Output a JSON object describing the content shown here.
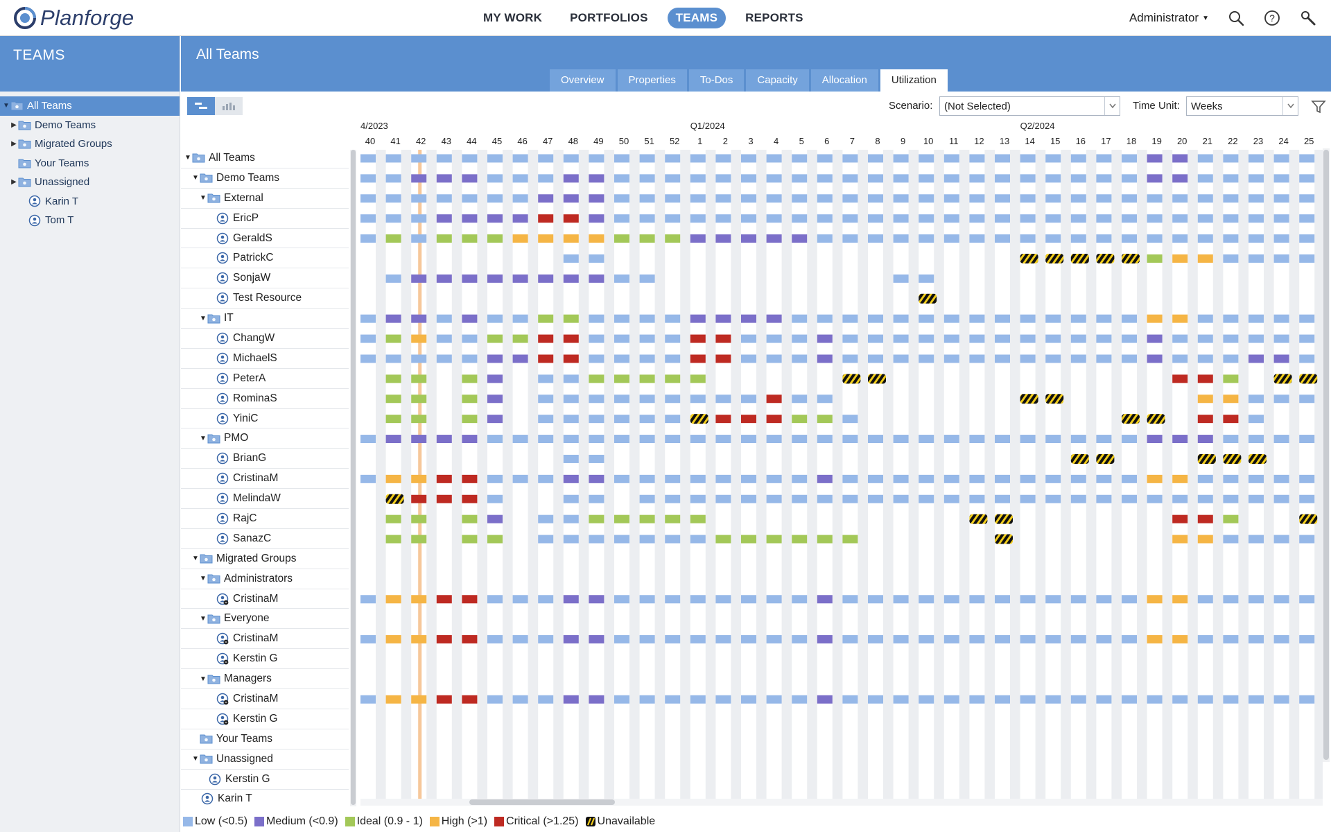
{
  "app": {
    "brand": "Planforge"
  },
  "nav": {
    "items": [
      "MY WORK",
      "PORTFOLIOS",
      "TEAMS",
      "REPORTS"
    ],
    "active": "TEAMS"
  },
  "user": {
    "name": "Administrator"
  },
  "icons": {
    "search": "search-icon",
    "help": "help-icon",
    "tools": "wrench-icon",
    "filter": "filter-icon"
  },
  "colors": {
    "brand_blue": "#5b8fcf",
    "low": "#96b8e8",
    "medium": "#7b6fc9",
    "ideal": "#a3c858",
    "high": "#f5b545",
    "critical": "#be2a22",
    "unavailable_stripe": "#f2cd1a"
  },
  "leftpanel": {
    "title": "TEAMS",
    "items": [
      {
        "label": "All Teams",
        "kind": "group",
        "level": 0,
        "expanded": true,
        "selected": true
      },
      {
        "label": "Demo Teams",
        "kind": "group",
        "level": 1,
        "expanded": false
      },
      {
        "label": "Migrated Groups",
        "kind": "group",
        "level": 1,
        "expanded": false
      },
      {
        "label": "Your Teams",
        "kind": "group",
        "level": 1,
        "leaf": true
      },
      {
        "label": "Unassigned",
        "kind": "group",
        "level": 1,
        "expanded": false
      },
      {
        "label": "Karin T",
        "kind": "person",
        "level": 1
      },
      {
        "label": "Tom T",
        "kind": "person",
        "level": 1
      }
    ]
  },
  "main": {
    "title": "All Teams",
    "tabs": [
      "Overview",
      "Properties",
      "To-Dos",
      "Capacity",
      "Allocation",
      "Utilization"
    ],
    "active_tab": "Utilization"
  },
  "toolbar": {
    "scenario_label": "Scenario:",
    "scenario_value": "(Not Selected)",
    "timeunit_label": "Time Unit:",
    "timeunit_value": "Weeks"
  },
  "tree": [
    {
      "label": "All Teams",
      "level": 0,
      "kind": "group",
      "expanded": true
    },
    {
      "label": "Demo Teams",
      "level": 1,
      "kind": "group",
      "expanded": true
    },
    {
      "label": "External",
      "level": 2,
      "kind": "group",
      "expanded": true
    },
    {
      "label": "EricP",
      "level": 3,
      "kind": "person"
    },
    {
      "label": "GeraldS",
      "level": 3,
      "kind": "person"
    },
    {
      "label": "PatrickC",
      "level": 3,
      "kind": "person"
    },
    {
      "label": "SonjaW",
      "level": 3,
      "kind": "person"
    },
    {
      "label": "Test Resource",
      "level": 3,
      "kind": "person"
    },
    {
      "label": "IT",
      "level": 2,
      "kind": "group",
      "expanded": true
    },
    {
      "label": "ChangW",
      "level": 3,
      "kind": "person"
    },
    {
      "label": "MichaelS",
      "level": 3,
      "kind": "person"
    },
    {
      "label": "PeterA",
      "level": 3,
      "kind": "person"
    },
    {
      "label": "RominaS",
      "level": 3,
      "kind": "person"
    },
    {
      "label": "YiniC",
      "level": 3,
      "kind": "person"
    },
    {
      "label": "PMO",
      "level": 2,
      "kind": "group",
      "expanded": true
    },
    {
      "label": "BrianG",
      "level": 3,
      "kind": "person"
    },
    {
      "label": "CristinaM",
      "level": 3,
      "kind": "person"
    },
    {
      "label": "MelindaW",
      "level": 3,
      "kind": "person"
    },
    {
      "label": "RajC",
      "level": 3,
      "kind": "person"
    },
    {
      "label": "SanazC",
      "level": 3,
      "kind": "person"
    },
    {
      "label": "Migrated Groups",
      "level": 1,
      "kind": "group",
      "expanded": true
    },
    {
      "label": "Administrators",
      "level": 2,
      "kind": "group",
      "expanded": true
    },
    {
      "label": "CristinaM",
      "level": 3,
      "kind": "migrated"
    },
    {
      "label": "Everyone",
      "level": 2,
      "kind": "group",
      "expanded": true
    },
    {
      "label": "CristinaM",
      "level": 3,
      "kind": "migrated"
    },
    {
      "label": "Kerstin G",
      "level": 3,
      "kind": "migrated"
    },
    {
      "label": "Managers",
      "level": 2,
      "kind": "group",
      "expanded": true
    },
    {
      "label": "CristinaM",
      "level": 3,
      "kind": "migrated"
    },
    {
      "label": "Kerstin G",
      "level": 3,
      "kind": "migrated"
    },
    {
      "label": "Your Teams",
      "level": 1,
      "kind": "group",
      "leaf": true
    },
    {
      "label": "Unassigned",
      "level": 1,
      "kind": "group",
      "expanded": true
    },
    {
      "label": "Kerstin G",
      "level": 2,
      "kind": "person"
    },
    {
      "label": "Karin T",
      "level": 1,
      "kind": "person"
    }
  ],
  "timeline": {
    "period_labels": [
      {
        "label": "4/2023",
        "col": 0
      },
      {
        "label": "Q1/2024",
        "col": 13
      },
      {
        "label": "Q2/2024",
        "col": 26
      }
    ],
    "weeks": [
      "40",
      "41",
      "42",
      "43",
      "44",
      "45",
      "46",
      "47",
      "48",
      "49",
      "50",
      "51",
      "52",
      "1",
      "2",
      "3",
      "4",
      "5",
      "6",
      "7",
      "8",
      "9",
      "10",
      "11",
      "12",
      "13",
      "14",
      "15",
      "16",
      "17",
      "18",
      "19",
      "20",
      "21",
      "22",
      "23",
      "24",
      "25"
    ],
    "current_week_index": 2
  },
  "utilization_rows": [
    "LLLLLLLLLLLLLLLLLLLLLLLLLLLLLLLMMLLLLL",
    "LLMMMLLLMMLLLLLLLLLLLLLLLLLLLLLMMLLLLL",
    "LLLLLLLMMMLLLLLLLLLLLLLLLLLLLLLLLLLLLL",
    "LLLMMMMCCMLLLLLLLLLLLLLLLLLLLLLLLLLLLL",
    "LILIIIHHHHIIIMMMMMLLLLLLLLLLLLLLLLLLLL",
    "........LL................UUUUUIHHLLLL",
    ".LMMMMMMMMLL.........LL...............",
    "......................U...............",
    "LMMLMLLIILLLLMMMMLLLLLLLLLLLLLLHHLLLLL",
    "LIHLLIICCLLLLCCLLLMLLLLLLLLLLLLMLLLLLL",
    "LLLLLMMCCLLLLCCLLLMLLLLLLLLLLLLMLLLMML",
    ".II.IM.LLIIIII.....UU...........CCI.UU",
    ".II.IM.LLLLLLLLLCLL.......UU.....HHLLL",
    ".II.IM.LLLLLLUCCCIIL..........UU.CCL..",
    "LMMMMLLLLLLLLLLLLLLLLLLLLLLLLLLMMMLLLL",
    "........LL..................UU...UUU..",
    "LHHCCLLLMMLLLLLLLLMLLLLLLLLLLLLHHLLLLL",
    ".UCCCL..LL.LLLLLLLLLLLLLLLLLLLLLLLLLLL",
    ".II.IM.LLIIIII..........UU......CCI..U",
    ".II.II.LLLLLLLIIIIII.....U......HHLLLL",
    "......................................",
    "......................................",
    "LHHCCLLLMMLLLLLLLLMLLLLLLLLLLLLHHLLLLL",
    "......................................",
    "LHHCCLLLMMLLLLLLLLMLLLLLLLLLLLLHHLLLLL",
    "......................................",
    "......................................",
    "LHHCCLLLMMLLLLLLLLMLLLLLLLLLLLLLLLLLLL",
    "......................................",
    "......................................",
    "......................................",
    "......................................",
    "......................................"
  ],
  "legend": [
    {
      "code": "L",
      "label": "Low (<0.5)"
    },
    {
      "code": "M",
      "label": "Medium (<0.9)"
    },
    {
      "code": "I",
      "label": "Ideal (0.9 - 1)"
    },
    {
      "code": "H",
      "label": "High (>1)"
    },
    {
      "code": "C",
      "label": "Critical (>1.25)"
    },
    {
      "code": "U",
      "label": "Unavailable"
    }
  ]
}
